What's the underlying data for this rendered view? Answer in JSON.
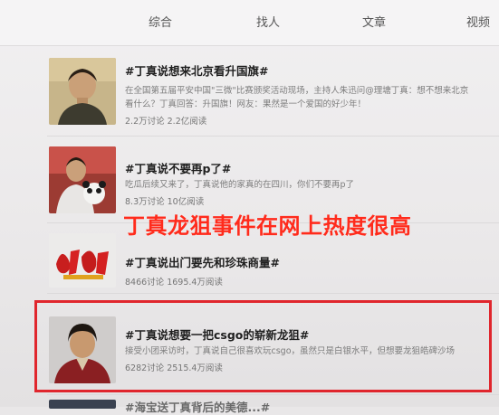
{
  "tabs": [
    "综合",
    "找人",
    "文章",
    "视频"
  ],
  "results": [
    {
      "title": "#丁真说想来北京看升国旗#",
      "snippet_lines": [
        "在全国第五届平安中国\"三微\"比赛颁奖活动现场，主持人朱迅问@理塘丁真：想不想来北京",
        "看什么？丁真回答：升国旗！网友：果然是一个爱国的好少年！"
      ],
      "stats": "2.2万讨论 2.2亿阅读",
      "thumb_icon": "boy-portrait-thumbnail"
    },
    {
      "title": "#丁真说不要再p了#",
      "snippet_lines": [
        "吃瓜后续又来了，丁真说他的家真的在四川，你们不要再p了"
      ],
      "stats": "8.3万讨论 10亿阅读",
      "thumb_icon": "boy-with-panda-thumbnail"
    },
    {
      "title": "#丁真说出门要先和珍珠商量#",
      "snippet_lines": [],
      "stats": "8466讨论 1695.4万阅读",
      "thumb_icon": "red-calligraphy-logo-thumbnail"
    },
    {
      "title": "#丁真说想要一把csgo的崭新龙狙#",
      "snippet_lines": [
        "接受小团采访时，丁真说自己很喜欢玩csgo，虽然只是白银水平，但想要龙狙皓碑沙场"
      ],
      "stats": "6282讨论 2515.4万阅读",
      "thumb_icon": "boy-red-robe-thumbnail"
    },
    {
      "title": "#海宝送丁真背后的美德...#"
    }
  ],
  "overlay_caption": "丁真龙狙事件在网上热度很高",
  "colors": {
    "overlay_text": "#ff2b1c",
    "highlight_border": "#e0262d"
  }
}
